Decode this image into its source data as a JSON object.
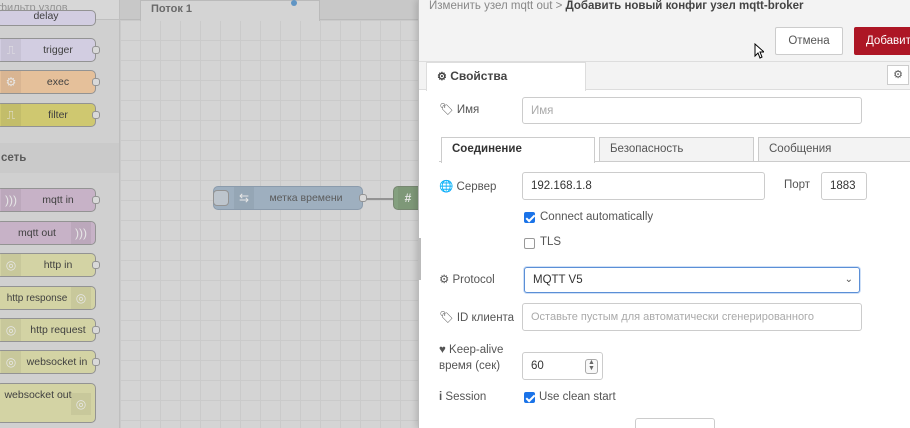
{
  "palette": {
    "search_placeholder": "фильтр узлов",
    "category_network": "сеть",
    "nodes": [
      {
        "label": "delay",
        "color": "#e2d96e"
      },
      {
        "label": "trigger",
        "color": "#e6e0f8"
      },
      {
        "label": "exec",
        "color": "#fdd0a2"
      },
      {
        "label": "filter",
        "color": "#e2d96e"
      },
      {
        "label": "mqtt in",
        "color": "#d8bfd8"
      },
      {
        "label": "mqtt out",
        "color": "#d8bfd8"
      },
      {
        "label": "http in",
        "color": "#e7e7ae"
      },
      {
        "label": "http response",
        "color": "#e7e7ae"
      },
      {
        "label": "http request",
        "color": "#e7e7ae"
      },
      {
        "label": "websocket in",
        "color": "#e7e7ae"
      },
      {
        "label": "websocket out",
        "color": "#e7e7ae"
      }
    ]
  },
  "workspace": {
    "tab_label": "Поток 1",
    "inject_node_label": "метка времени",
    "inject_color": "#a6bbcf"
  },
  "tray": {
    "breadcrumb_parent": "Изменить узел mqtt out >",
    "breadcrumb_current": "Добавить новый конфиг узел mqtt-broker",
    "cancel_label": "Отмена",
    "add_label": "Добавить",
    "properties_tab": "Свойства",
    "name_label": "Имя",
    "name_placeholder": "Имя",
    "tabs": [
      "Соединение",
      "Безопасность",
      "Сообщения"
    ],
    "server_label": "Сервер",
    "server_value": "192.168.1.8",
    "port_label": "Порт",
    "port_value": "1883",
    "connect_auto_label": "Connect automatically",
    "tls_label": "TLS",
    "protocol_label": "Protocol",
    "protocol_value": "MQTT V5",
    "client_id_label": "ID клиента",
    "client_id_placeholder": "Оставьте пустым для автоматически сгенерированного",
    "keepalive_label_1": "Keep-alive",
    "keepalive_label_2": "время (сек)",
    "keepalive_value": "60",
    "session_label": "Session",
    "clean_start_label": "Use clean start",
    "accent": "#ad1625"
  }
}
